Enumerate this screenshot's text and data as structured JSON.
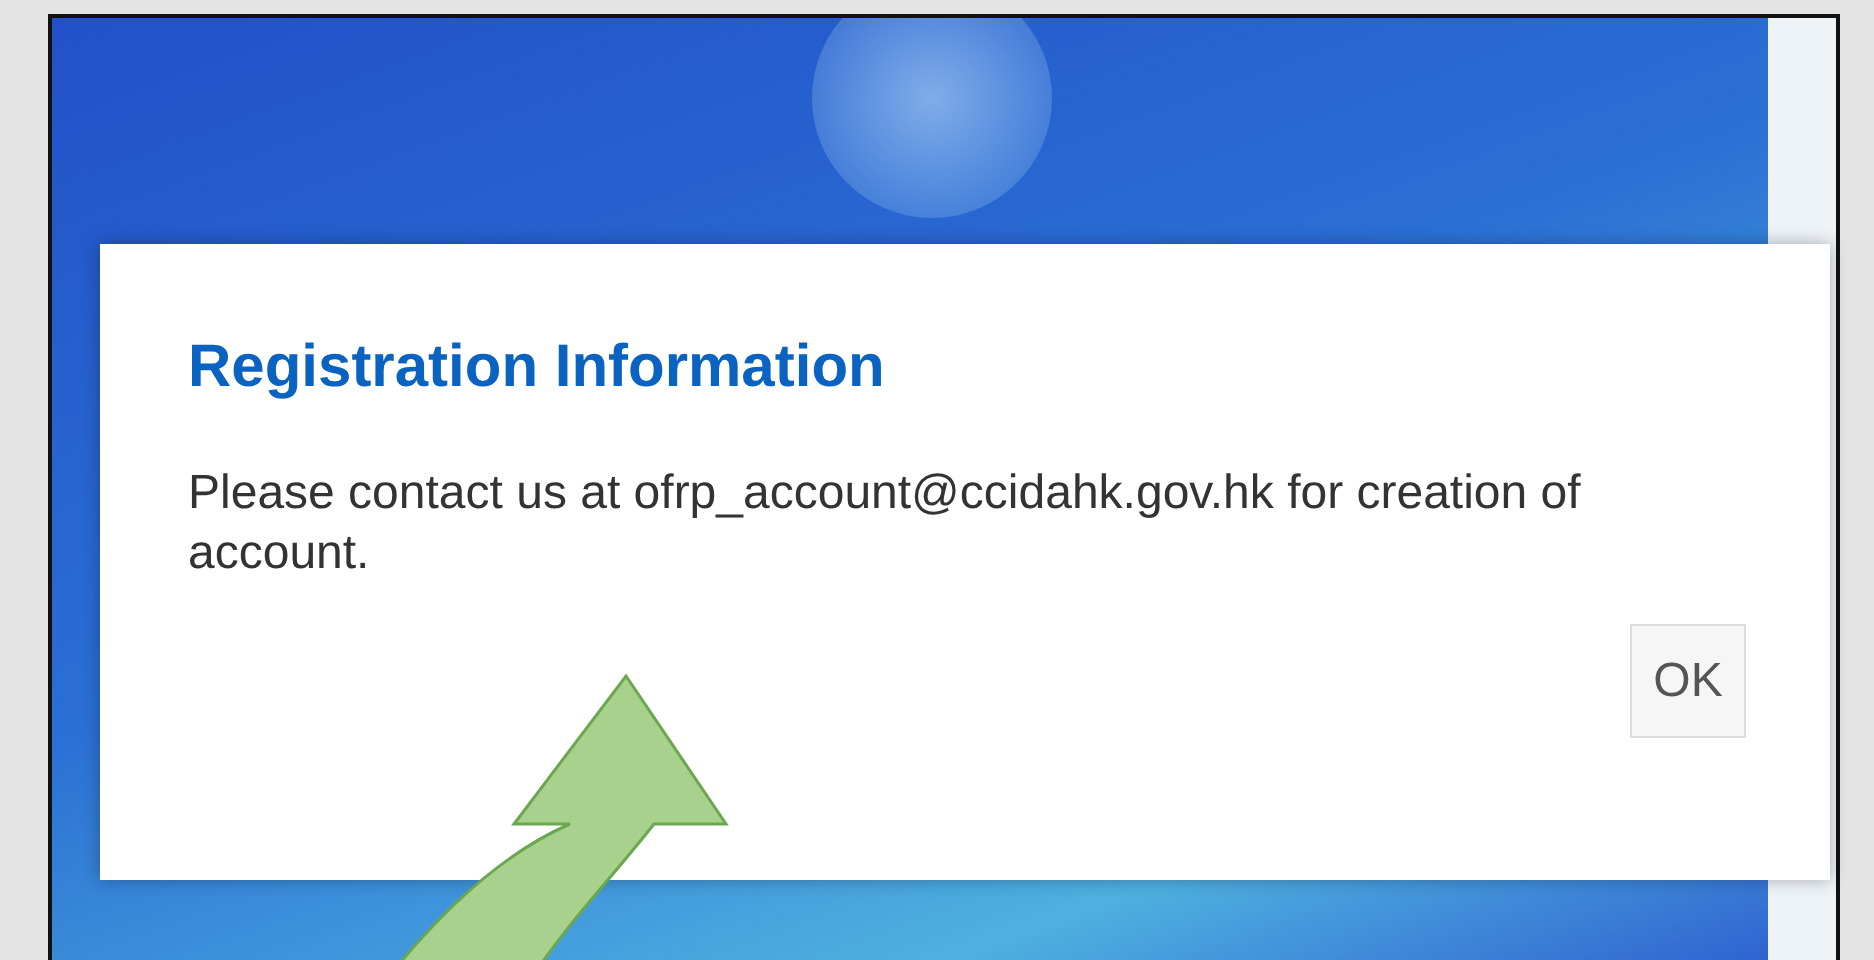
{
  "dialog": {
    "title": "Registration Information",
    "message": "Please contact us at ofrp_account@ccidahk.gov.hk for creation of account.",
    "buttons": [
      "OK"
    ]
  }
}
